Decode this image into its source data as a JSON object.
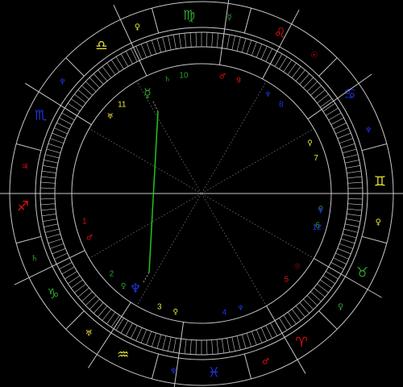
{
  "colors": {
    "background": "#000000",
    "lines": "#c8c8c8",
    "guide": "#777777",
    "aspect_line": "#22c322",
    "fire": "#e01010",
    "earth": "#2ea02e",
    "air": "#e6e632",
    "water": "#2233e6"
  },
  "signs": [
    {
      "name": "Aries",
      "glyph": "♈",
      "element": "fire"
    },
    {
      "name": "Taurus",
      "glyph": "♉",
      "element": "earth"
    },
    {
      "name": "Gemini",
      "glyph": "♊",
      "element": "air"
    },
    {
      "name": "Cancer",
      "glyph": "♋",
      "element": "water"
    },
    {
      "name": "Leo",
      "glyph": "♌",
      "element": "fire"
    },
    {
      "name": "Virgo",
      "glyph": "♍",
      "element": "earth"
    },
    {
      "name": "Libra",
      "glyph": "♎",
      "element": "air"
    },
    {
      "name": "Scorpio",
      "glyph": "♏",
      "element": "water"
    },
    {
      "name": "Sagittarius",
      "glyph": "♐",
      "element": "fire"
    },
    {
      "name": "Capricorn",
      "glyph": "♑",
      "element": "earth"
    },
    {
      "name": "Aquarius",
      "glyph": "♒",
      "element": "air"
    },
    {
      "name": "Pisces",
      "glyph": "♓",
      "element": "water"
    }
  ],
  "sign_rulers": [
    {
      "sign": "Aries",
      "glyph": "♂",
      "element": "fire"
    },
    {
      "sign": "Taurus",
      "glyph": "♀",
      "element": "earth"
    },
    {
      "sign": "Gemini",
      "glyph": "♀",
      "element": "air"
    },
    {
      "sign": "Cancer",
      "glyph": "♆",
      "element": "water"
    },
    {
      "sign": "Leo",
      "glyph": "☉",
      "element": "fire"
    },
    {
      "sign": "Virgo",
      "glyph": "☿",
      "element": "earth"
    },
    {
      "sign": "Libra",
      "glyph": "♀",
      "element": "air"
    },
    {
      "sign": "Scorpio",
      "glyph": "♆",
      "element": "water"
    },
    {
      "sign": "Sagittarius",
      "glyph": "♃",
      "element": "fire"
    },
    {
      "sign": "Capricorn",
      "glyph": "♄",
      "element": "earth"
    },
    {
      "sign": "Aquarius",
      "glyph": "♅",
      "element": "air"
    },
    {
      "sign": "Pisces",
      "glyph": "♆",
      "element": "water"
    }
  ],
  "houses": [
    {
      "number": "1",
      "element": "fire"
    },
    {
      "number": "2",
      "element": "earth"
    },
    {
      "number": "3",
      "element": "air"
    },
    {
      "number": "4",
      "element": "water"
    },
    {
      "number": "5",
      "element": "fire"
    },
    {
      "number": "6",
      "element": "earth"
    },
    {
      "number": "7",
      "element": "air"
    },
    {
      "number": "8",
      "element": "water"
    },
    {
      "number": "9",
      "element": "fire"
    },
    {
      "number": "10",
      "element": "earth"
    },
    {
      "number": "11",
      "element": "air"
    },
    {
      "number": "12",
      "element": "water"
    }
  ],
  "house_rulers": [
    {
      "house": "1",
      "glyph": "♂",
      "element": "fire"
    },
    {
      "house": "2",
      "glyph": "♀",
      "element": "earth"
    },
    {
      "house": "3",
      "glyph": "♀",
      "element": "air"
    },
    {
      "house": "4",
      "glyph": "♆",
      "element": "water"
    },
    {
      "house": "5",
      "glyph": "☉",
      "element": "fire"
    },
    {
      "house": "6",
      "glyph": "♀",
      "element": "earth"
    },
    {
      "house": "7",
      "glyph": "♀",
      "element": "air"
    },
    {
      "house": "8",
      "glyph": "♆",
      "element": "water"
    },
    {
      "house": "9",
      "glyph": "♂",
      "element": "fire"
    },
    {
      "house": "10",
      "glyph": "♄",
      "element": "earth"
    },
    {
      "house": "11",
      "glyph": "♅",
      "element": "air"
    },
    {
      "house": "12",
      "glyph": "♆",
      "element": "water"
    }
  ],
  "planets": [
    {
      "name": "Mercury",
      "glyph": "☿",
      "element": "earth"
    },
    {
      "name": "Neptune",
      "glyph": "♆",
      "element": "water"
    }
  ],
  "aspects": [
    {
      "from": "Mercury",
      "to": "Neptune",
      "color": "#22c322"
    }
  ]
}
